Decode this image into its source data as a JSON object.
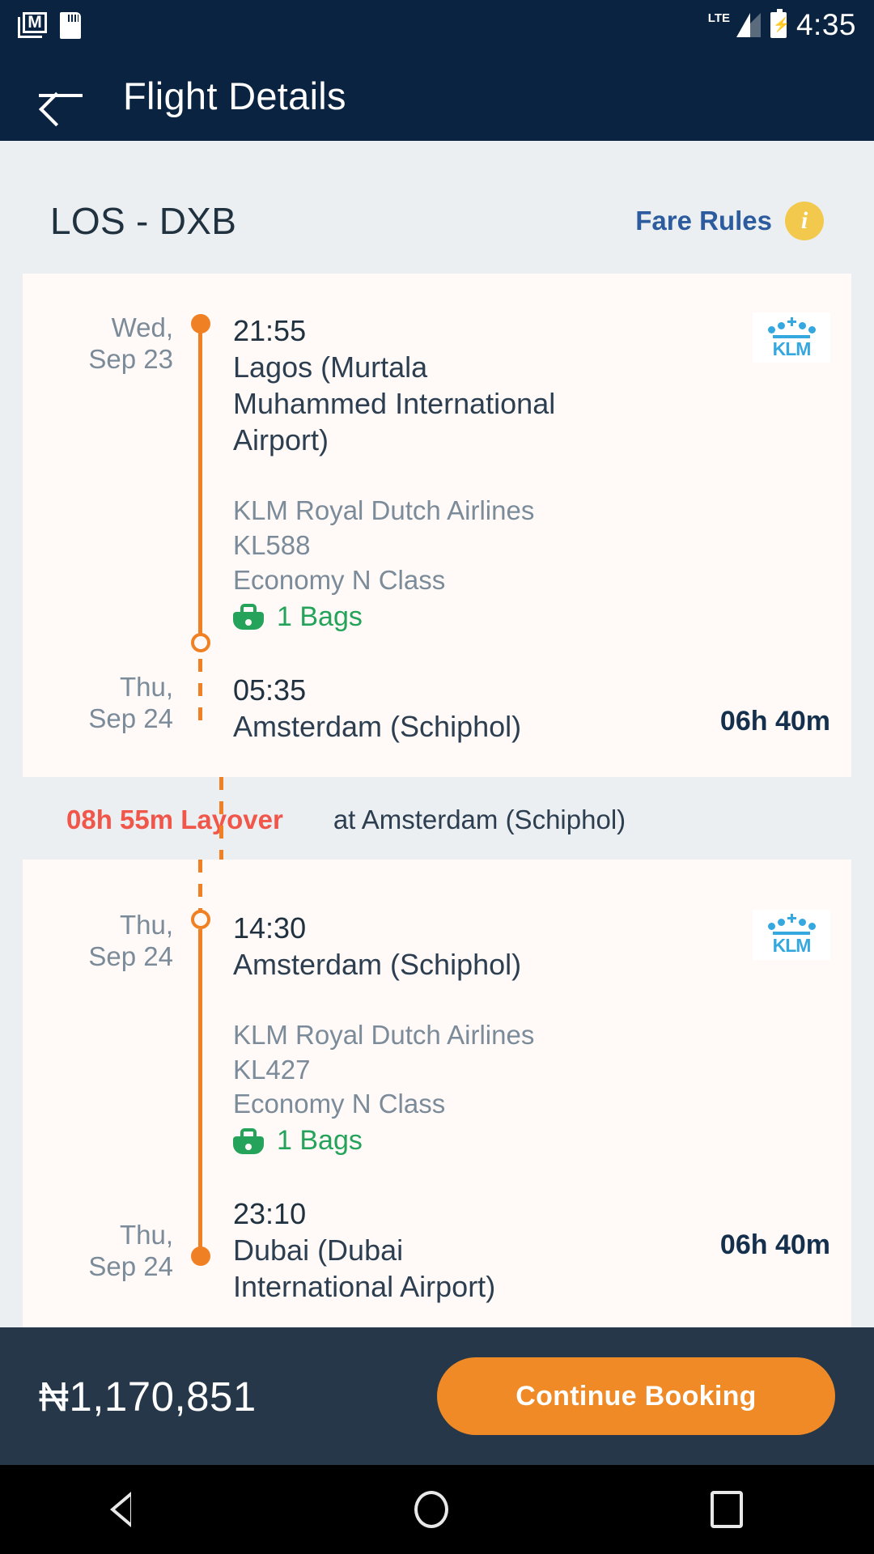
{
  "status_bar": {
    "time": "4:35",
    "network": "LTE",
    "icons": [
      "gmail-icon",
      "sd-card-icon",
      "signal-icon",
      "battery-icon"
    ]
  },
  "app_bar": {
    "title": "Flight Details",
    "back_icon": "back-arrow-icon"
  },
  "route": {
    "title": "LOS - DXB",
    "fare_rules_label": "Fare Rules",
    "info_icon": "info-icon"
  },
  "segments": [
    {
      "departure": {
        "day": "Wed,",
        "date": "Sep 23",
        "time": "21:55",
        "place": "Lagos (Murtala Muhammed International Airport)"
      },
      "airline": "KLM Royal Dutch Airlines",
      "flight_number": "KL588",
      "cabin": "Economy N Class",
      "baggage": "1 Bags",
      "airline_logo": "klm-logo",
      "arrival": {
        "day": "Thu,",
        "date": "Sep 24",
        "time": "05:35",
        "place": "Amsterdam (Schiphol)"
      },
      "duration": "06h 40m"
    },
    {
      "departure": {
        "day": "Thu,",
        "date": "Sep 24",
        "time": "14:30",
        "place": "Amsterdam (Schiphol)"
      },
      "airline": "KLM Royal Dutch Airlines",
      "flight_number": "KL427",
      "cabin": "Economy N Class",
      "baggage": "1 Bags",
      "airline_logo": "klm-logo",
      "arrival": {
        "day": "Thu,",
        "date": "Sep 24",
        "time": "23:10",
        "place": "Dubai (Dubai International Airport)"
      },
      "duration": "06h 40m"
    }
  ],
  "layover": {
    "duration": "08h 55m Layover",
    "location": "at Amsterdam (Schiphol)"
  },
  "bottom_bar": {
    "price": "₦1,170,851",
    "cta_label": "Continue Booking"
  },
  "nav_bar": {
    "back": "nav-back-icon",
    "home": "nav-home-icon",
    "recent": "nav-recent-icon"
  },
  "colors": {
    "brand_dark": "#0a2340",
    "accent_orange": "#ef8023",
    "cta_orange": "#ef8a26",
    "layover_red": "#f0564a",
    "bag_green": "#25a35a",
    "link_blue": "#2c5c9e",
    "badge_yellow": "#f2c94c",
    "klm_blue": "#35a8e0"
  }
}
